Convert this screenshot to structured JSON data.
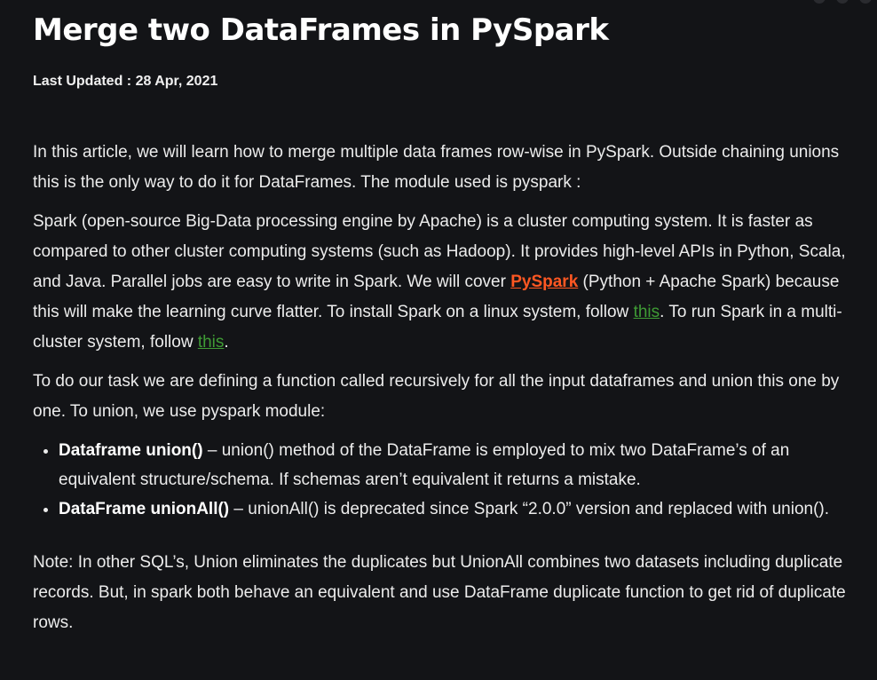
{
  "article": {
    "title": "Merge two DataFrames in PySpark",
    "updated_label": "Last Updated : ",
    "updated_date": "28 Apr, 2021",
    "intro": "In this article, we will learn how to merge multiple data frames row-wise in PySpark. Outside chaining unions this is the only way to do it for DataFrames. The module used is pyspark :",
    "spark_para": {
      "part1": "Spark (open-source Big-Data processing engine by Apache) is a cluster computing system. It is faster as compared to other cluster computing systems (such as Hadoop). It provides high-level APIs in Python, Scala, and Java. Parallel jobs are easy to write in Spark. We will cover ",
      "pyspark_link": "PySpark",
      "part2": " (Python + Apache Spark) because this will make the learning curve flatter. To install Spark on a linux system, follow ",
      "link1": "this",
      "part3": ". To run Spark in a multi-cluster system, follow ",
      "link2": "this",
      "part4": "."
    },
    "task_para": "To do our task we are defining a function called recursively for all the input dataframes and union this one by one. To union, we use pyspark module:",
    "bullets": [
      {
        "term": "Dataframe union()",
        "desc": " – union() method of the DataFrame is employed to mix two DataFrame’s of an equivalent structure/schema. If schemas aren’t equivalent it returns a mistake."
      },
      {
        "term": "DataFrame unionAll()",
        "desc": " – unionAll() is deprecated since Spark “2.0.0” version and replaced with union()."
      }
    ],
    "note": "Note: In other SQL’s, Union eliminates the duplicates but UnionAll combines two datasets including duplicate records. But, in spark both behave an equivalent and use DataFrame duplicate function to get rid of duplicate rows."
  },
  "colors": {
    "background": "#131417",
    "link_orange": "#ff5722",
    "link_green": "#3f9c35"
  }
}
